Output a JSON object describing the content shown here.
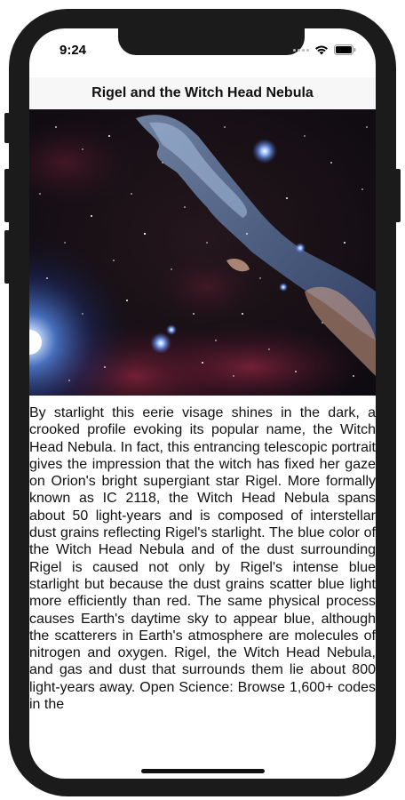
{
  "status_bar": {
    "time": "9:24",
    "signal_icon": "cellular-signal-dots-icon",
    "wifi_icon": "wifi-icon",
    "battery_icon": "battery-icon"
  },
  "nav": {
    "title": "Rigel and the Witch Head Nebula"
  },
  "image": {
    "description_icon": "nebula-photo"
  },
  "article": {
    "body": "By starlight this eerie visage shines in the dark, a crooked profile evoking its popular name, the Witch Head Nebula. In fact, this entrancing telescopic portrait gives the impression that the witch has fixed her gaze on Orion's bright supergiant star Rigel. More formally known as IC 2118, the Witch Head Nebula spans about 50 light-years and is composed of interstellar dust grains reflecting Rigel's starlight. The blue color of the Witch Head Nebula and of the dust surrounding Rigel is caused not only by Rigel's intense blue starlight but because the dust grains scatter blue light more efficiently than red. The same physical process causes Earth's daytime sky to appear blue, although the scatterers in Earth's atmosphere are molecules of nitrogen and oxygen. Rigel, the Witch Head Nebula, and gas and dust that surrounds them lie about 800 light-years away. Open Science: Browse 1,600+ codes in the"
  },
  "colors": {
    "nav_background": "#f7f7f7",
    "phone_frame": "#1b1b1b",
    "text": "#111111"
  }
}
